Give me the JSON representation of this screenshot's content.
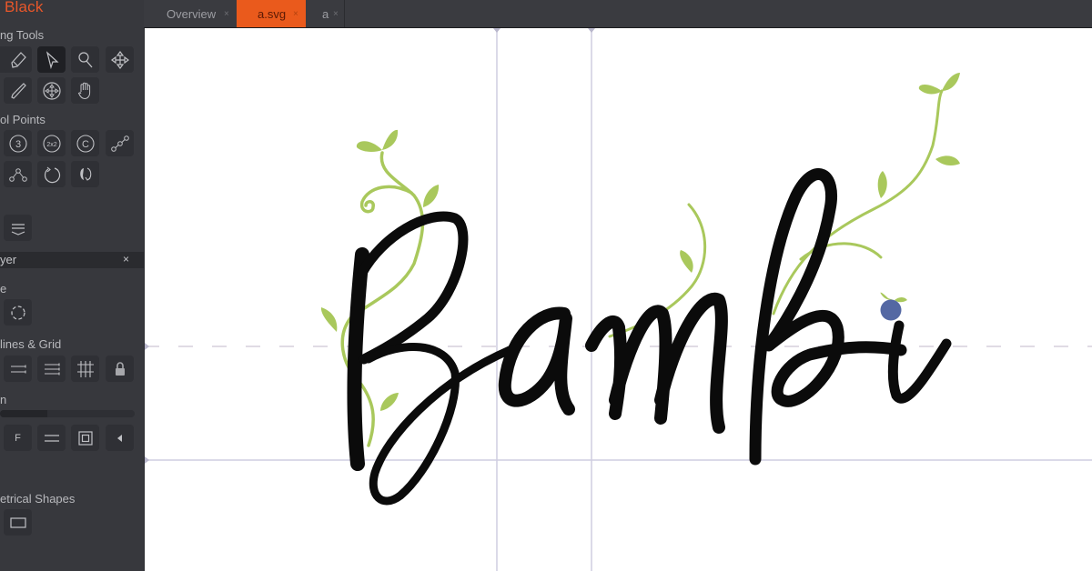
{
  "app": {
    "title": "Black"
  },
  "sidebar": {
    "sections": {
      "drawing_tools": "ng Tools",
      "control_points": "ol Points",
      "layer_panel": "yer",
      "shape": "e",
      "guidelines": "lines & Grid",
      "fill": "n",
      "geometric_shapes": "etrical Shapes"
    },
    "layer_close": "×",
    "fill_label": "F",
    "counter_3": "3",
    "counter_2x2": "2x2",
    "counter_c": "C",
    "opacity_fraction": 0.35
  },
  "tabs": [
    {
      "label": "Overview",
      "close": "×",
      "active": false
    },
    {
      "label": "a.svg",
      "close": "×",
      "active": true
    },
    {
      "label": "a",
      "close": "×",
      "active": false
    }
  ],
  "canvas": {
    "artwork_text": "Bambi",
    "colors": {
      "ink": "#0b0b0b",
      "vine": "#a9c85c",
      "berry": "#5468a3",
      "guide": "#c9c7dc",
      "accent": "#ea5a1c"
    }
  }
}
